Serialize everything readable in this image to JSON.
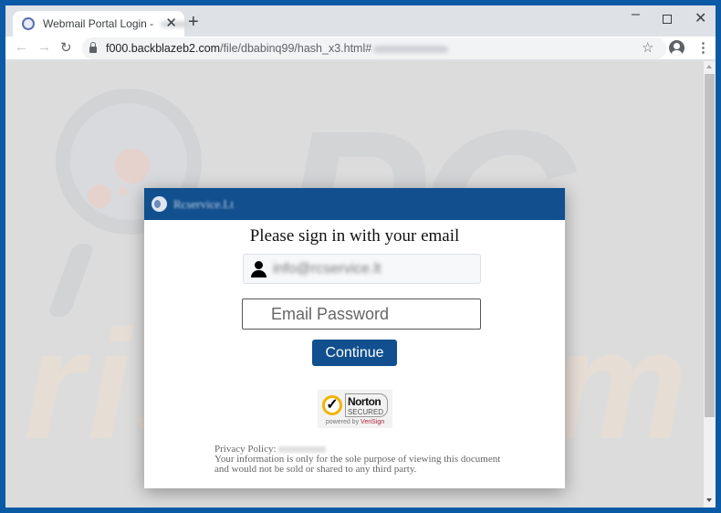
{
  "browser": {
    "tab": {
      "title": "Webmail Portal Login - ",
      "title_redacted": true,
      "favicon": "globe-icon"
    },
    "new_tab_label": "+",
    "window_controls": {
      "minimize": "–",
      "close": "✕"
    },
    "toolbar": {
      "back": "←",
      "forward": "→",
      "reload": "↻",
      "url_host": "f000.backblazeb2.com",
      "url_path": "/file/dbabinq99/hash_x3.html#",
      "url_fragment_redacted": true,
      "bookmark_icon": "☆",
      "menu_icon": "⋮"
    }
  },
  "watermark": {
    "text_bottom": "risk.com",
    "text_top": "PC"
  },
  "dialog": {
    "brand": "Rcservice.Lt",
    "title": "Please sign in with your email",
    "email_value": "info@rcservice.lt",
    "password_placeholder": "Email Password",
    "continue_label": "Continue",
    "norton": {
      "name": "Norton",
      "secured": "SECURED",
      "powered_prefix": "powered by ",
      "powered_brand": "VeriSign",
      "check": "✓"
    },
    "privacy": {
      "label": "Privacy Policy: ",
      "line1": "Your information is only for the sole purpose of viewing this document",
      "line2": "and would not be sold or shared to any third party."
    }
  }
}
